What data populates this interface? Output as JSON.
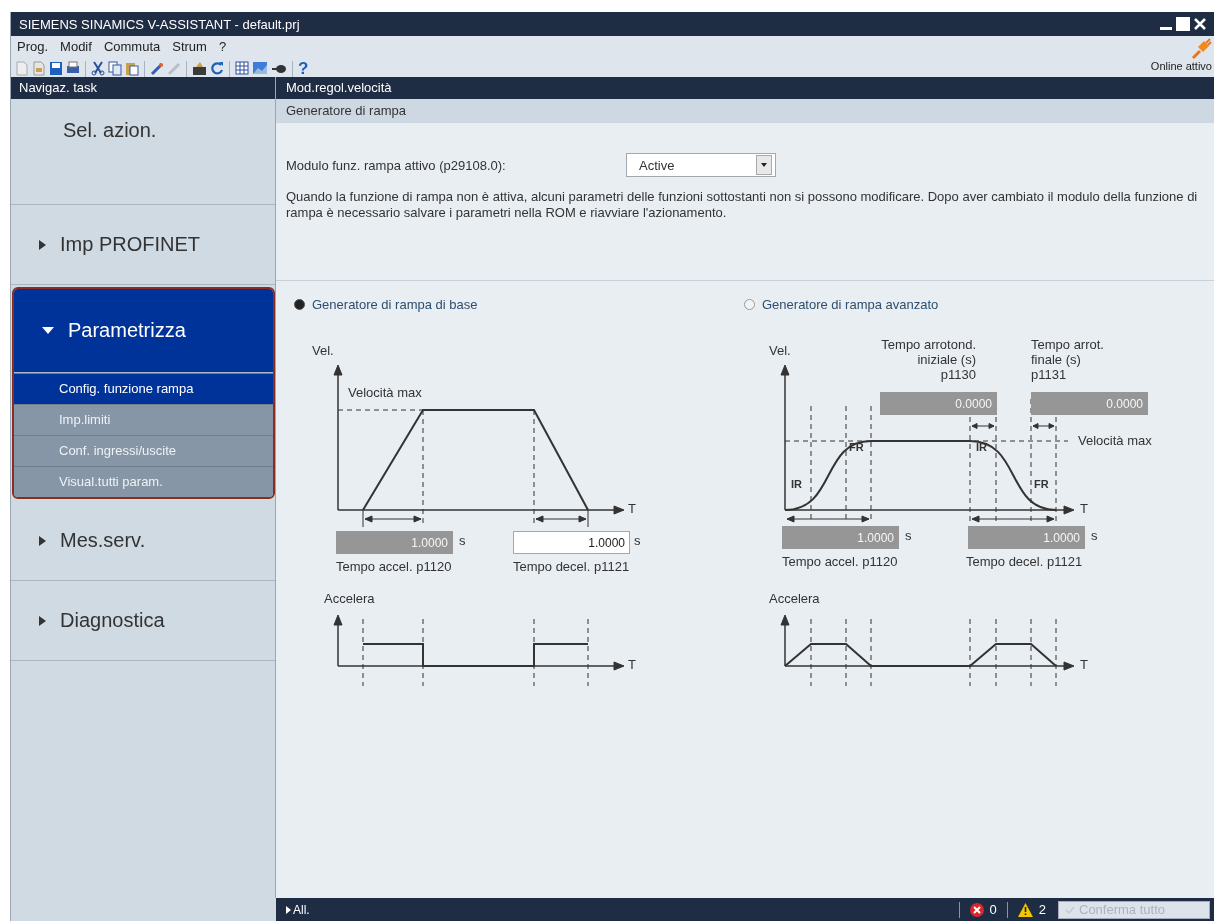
{
  "window": {
    "title": "SIEMENS SINAMICS V-ASSISTANT - default.prj"
  },
  "menu": [
    {
      "label": "Prog."
    },
    {
      "label": "Modif"
    },
    {
      "label": "Commuta"
    },
    {
      "label": "Strum"
    },
    {
      "label": "?"
    }
  ],
  "toolbar": {
    "help_label": "?",
    "connection_status": "Online attivo"
  },
  "sidebar": {
    "title": "Navigaz. task",
    "items": [
      {
        "label": "Sel. azion.",
        "kind": "plain",
        "selected": false
      },
      {
        "label": "Imp PROFINET",
        "kind": "group",
        "expanded": false,
        "selected": false
      },
      {
        "label": "Parametrizza",
        "kind": "group",
        "expanded": true,
        "selected": true,
        "children": [
          {
            "label": "Config. funzione rampa",
            "selected": true
          },
          {
            "label": "Imp.limiti",
            "selected": false
          },
          {
            "label": "Conf. ingressi/uscite",
            "selected": false
          },
          {
            "label": "Visual.tutti param.",
            "selected": false
          }
        ]
      },
      {
        "label": "Mes.serv.",
        "kind": "group",
        "expanded": false,
        "selected": false
      },
      {
        "label": "Diagnostica",
        "kind": "group",
        "expanded": false,
        "selected": false
      }
    ]
  },
  "content": {
    "title": "Mod.regol.velocità",
    "section": "Generatore di rampa",
    "mode_label": "Modulo funz. rampa attivo (p29108.0):",
    "mode_value": "Active",
    "note": "Quando la funzione di rampa non è attiva, alcuni parametri delle funzioni sottostanti non si possono modificare. Dopo aver cambiato il modulo della funzione di rampa è necessario salvare i parametri nella ROM e riavviare l'azionamento.",
    "options": [
      {
        "kind": "basic",
        "label": "Generatore di rampa di base",
        "selected": true,
        "vel_label": "Vel.",
        "max_label": "Velocità max",
        "t_label": "T",
        "accel_label": "Accelera",
        "t2_label": "T",
        "accel": {
          "value": "1.0000",
          "unit": "s",
          "caption": "Tempo accel. p1120",
          "disabled": true
        },
        "decel": {
          "value": "1.0000",
          "unit": "s",
          "caption": "Tempo decel. p1121",
          "disabled": false
        }
      },
      {
        "kind": "advanced",
        "label": "Generatore di rampa avanzato",
        "selected": false,
        "vel_label": "Vel.",
        "max_label": "Velocità max",
        "t_label": "T",
        "accel_label": "Accelera",
        "t2_label": "T",
        "rounding": [
          {
            "lines": [
              "Tempo arrotond.",
              "iniziale (s)",
              "p1130"
            ],
            "value": "0.0000",
            "disabled": true
          },
          {
            "lines": [
              "Tempo arrot.",
              "finale (s)",
              "p1131"
            ],
            "value": "0.0000",
            "disabled": true
          }
        ],
        "markers": [
          "IR",
          "FR",
          "IR",
          "FR"
        ],
        "accel": {
          "value": "1.0000",
          "unit": "s",
          "caption": "Tempo accel. p1120",
          "disabled": true
        },
        "decel": {
          "value": "1.0000",
          "unit": "s",
          "caption": "Tempo decel. p1121",
          "disabled": true
        }
      }
    ]
  },
  "status_bar": {
    "filter": "All.",
    "errors": "0",
    "warnings": "2",
    "confirm": {
      "label": "Conferma tutto",
      "disabled": true
    }
  }
}
